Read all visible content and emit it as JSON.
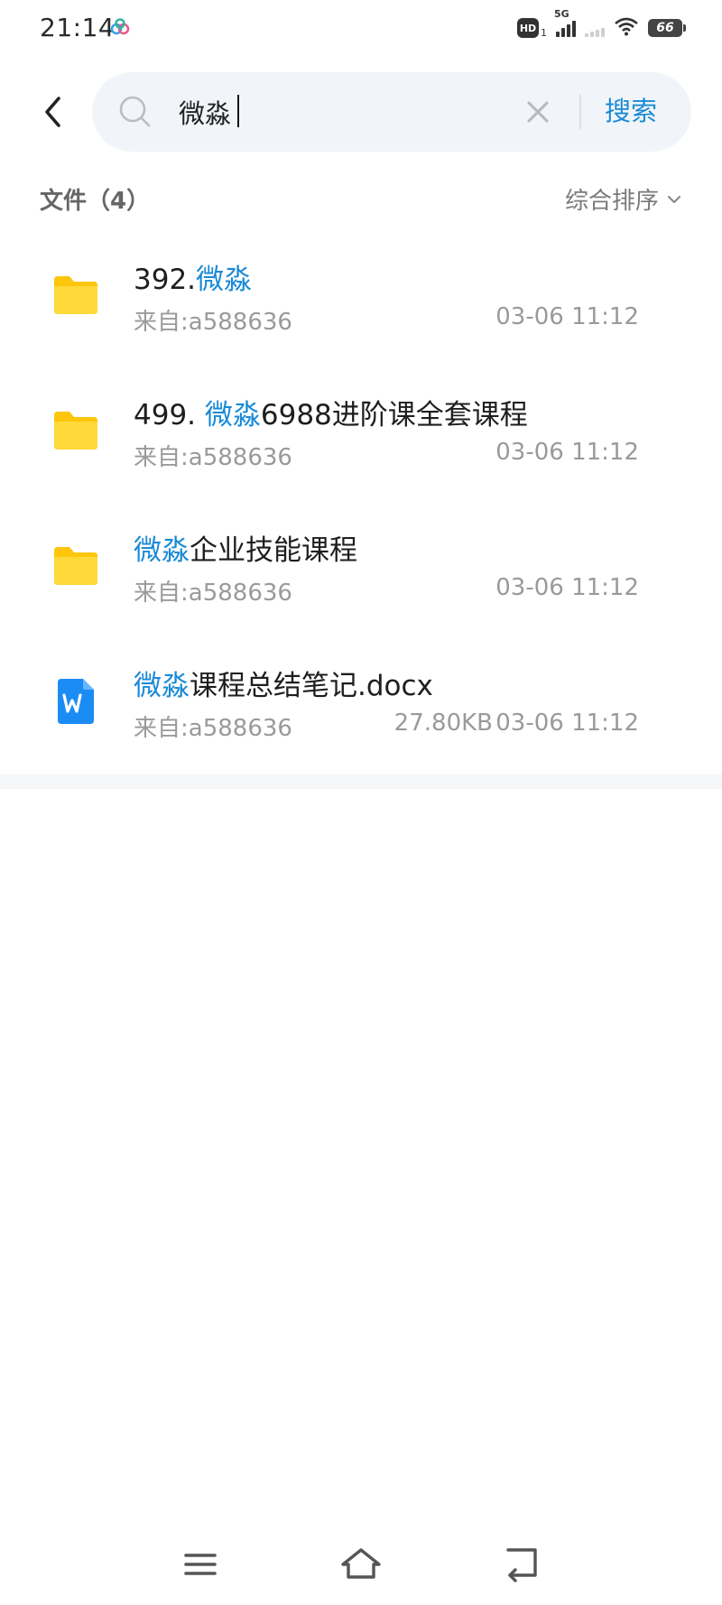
{
  "status_bar": {
    "time": "21:14",
    "hd_label": "HD",
    "hd_sub": "1",
    "network_label": "5G",
    "battery_level": "66",
    "icons": [
      "cloud-sync-icon",
      "hd-icon",
      "cellular-signal-icon",
      "secondary-signal-icon",
      "wifi-icon",
      "battery-icon"
    ]
  },
  "search": {
    "query": "微淼",
    "submit_label": "搜索",
    "icons": [
      "search-icon",
      "clear-icon"
    ]
  },
  "results": {
    "title": "文件（4）",
    "sort_label": "综合排序",
    "highlight_color": "#1a8ad6",
    "items": [
      {
        "type": "folder",
        "icon": "folder-icon",
        "name_prefix": "392.",
        "name_highlight": "微淼",
        "name_suffix": "",
        "source": "来自:a588636",
        "size": "",
        "date": "03-06 11:12"
      },
      {
        "type": "folder",
        "icon": "folder-icon",
        "name_prefix": "499. ",
        "name_highlight": "微淼",
        "name_suffix": "6988进阶课全套课程",
        "source": "来自:a588636",
        "size": "",
        "date": "03-06 11:12"
      },
      {
        "type": "folder",
        "icon": "folder-icon",
        "name_prefix": "",
        "name_highlight": "微淼",
        "name_suffix": "企业技能课程",
        "source": "来自:a588636",
        "size": "",
        "date": "03-06 11:12"
      },
      {
        "type": "document",
        "icon": "word-document-icon",
        "name_prefix": "",
        "name_highlight": "微淼",
        "name_suffix": "课程总结笔记.docx",
        "source": "来自:a588636",
        "size": "27.80KB",
        "date": "03-06 11:12"
      }
    ]
  },
  "nav_bar": {
    "buttons": [
      "menu-icon",
      "home-icon",
      "back-gesture-icon"
    ]
  }
}
